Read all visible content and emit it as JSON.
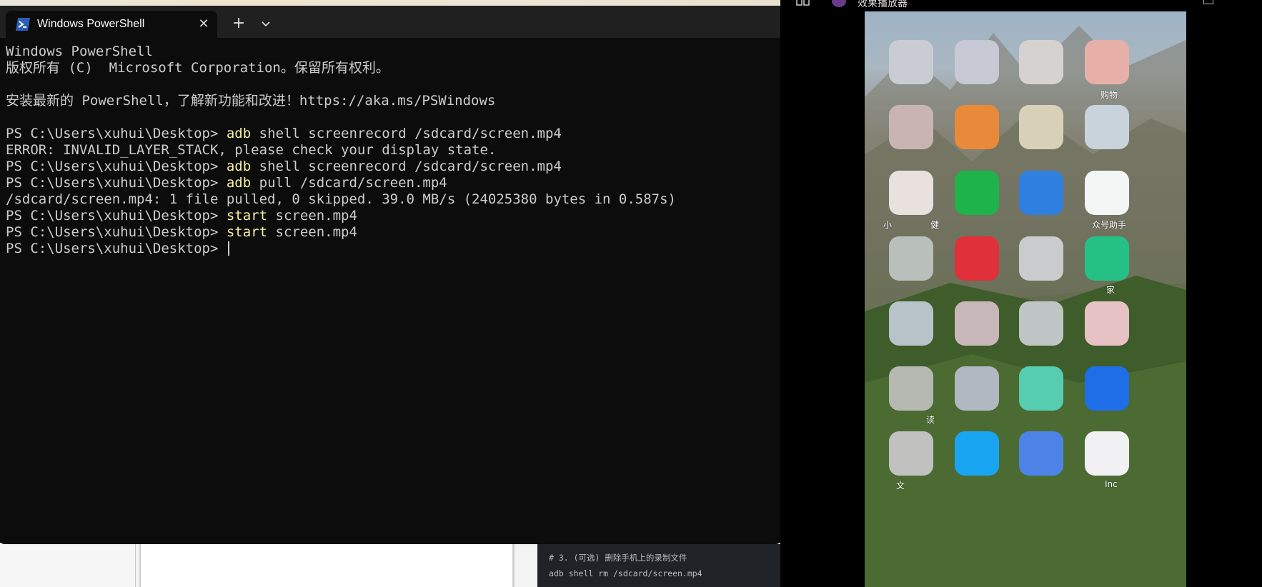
{
  "terminal": {
    "tab_title": "Windows PowerShell",
    "tab_icon": "powershell-icon",
    "close_glyph": "✕",
    "new_tab_glyph": "+",
    "dropdown_glyph": "⌄",
    "lines": [
      {
        "prompt": "",
        "cmd": "",
        "text": "Windows PowerShell"
      },
      {
        "prompt": "",
        "cmd": "",
        "text": "版权所有 (C)  Microsoft Corporation。保留所有权利。"
      },
      {
        "prompt": "",
        "cmd": "",
        "text": ""
      },
      {
        "prompt": "",
        "cmd": "",
        "text": "安装最新的 PowerShell，了解新功能和改进！https://aka.ms/PSWindows"
      },
      {
        "prompt": "",
        "cmd": "",
        "text": ""
      },
      {
        "prompt": "PS C:\\Users\\xuhui\\Desktop> ",
        "cmd": "adb",
        "text": " shell screenrecord /sdcard/screen.mp4"
      },
      {
        "prompt": "",
        "cmd": "",
        "text": "ERROR: INVALID_LAYER_STACK, please check your display state."
      },
      {
        "prompt": "PS C:\\Users\\xuhui\\Desktop> ",
        "cmd": "adb",
        "text": " shell screenrecord /sdcard/screen.mp4"
      },
      {
        "prompt": "PS C:\\Users\\xuhui\\Desktop> ",
        "cmd": "adb",
        "text": " pull /sdcard/screen.mp4"
      },
      {
        "prompt": "",
        "cmd": "",
        "text": "/sdcard/screen.mp4: 1 file pulled, 0 skipped. 39.0 MB/s (24025380 bytes in 0.587s)"
      },
      {
        "prompt": "PS C:\\Users\\xuhui\\Desktop> ",
        "cmd": "start",
        "text": " screen.mp4"
      },
      {
        "prompt": "PS C:\\Users\\xuhui\\Desktop> ",
        "cmd": "start",
        "text": " screen.mp4"
      },
      {
        "prompt": "PS C:\\Users\\xuhui\\Desktop> ",
        "cmd": "",
        "text": ""
      }
    ],
    "colors": {
      "background": "#0c0c0c",
      "text": "#cccccc",
      "command": "#f9f1a5",
      "tabbar": "#202020"
    }
  },
  "background_window": {
    "code_lines": [
      "# 3. (可选) 删除手机上的录制文件",
      "adb shell rm /sdcard/screen.mp4"
    ]
  },
  "mirror": {
    "title": "效果播放器",
    "labels": {
      "r1c4": "购物",
      "r3c1": "小",
      "r3c2": "健",
      "r3c4": "众号助手",
      "r4c4": "家",
      "r6c1": "读",
      "r7c1": "文",
      "r7c4": "Inc"
    }
  }
}
